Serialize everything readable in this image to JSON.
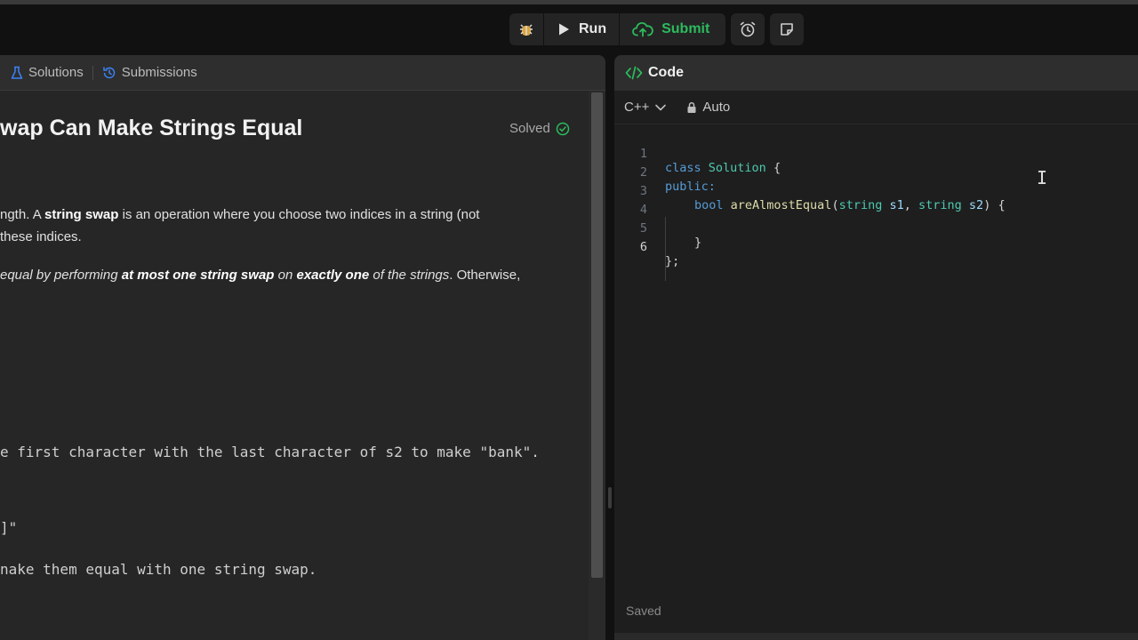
{
  "toolbar": {
    "run_label": "Run",
    "submit_label": "Submit",
    "submit_color": "#2cbb5d"
  },
  "left_tabs": [
    {
      "label": "Solutions",
      "icon": "flask-icon"
    },
    {
      "label": "Submissions",
      "icon": "history-icon"
    }
  ],
  "problem": {
    "title": "wap Can Make Strings Equal",
    "status": "Solved",
    "status_color": "#2cbb5d",
    "desc1_a": "ngth. A ",
    "desc1_b": "string swap",
    "desc1_c": " is an operation where you choose two indices in a string (not",
    "desc2": "these indices.",
    "desc3_a": "equal by performing ",
    "desc3_b": "at most one string swap",
    "desc3_c": " on ",
    "desc3_d": "exactly one",
    "desc3_e": " of the strings",
    "desc3_f": ". Otherwise,",
    "example1_explanation": "e first character with the last character of s2 to make \"bank\".",
    "example2_fragment": "]\"",
    "example2_explanation": "nake them equal with one string swap."
  },
  "editor": {
    "panel_title": "Code",
    "language": "C++",
    "mode": "Auto",
    "status": "Saved",
    "lines": [
      {
        "num": "1",
        "t1": "class ",
        "t2": "Solution",
        "t3": " {"
      },
      {
        "num": "2",
        "t1": "public:"
      },
      {
        "num": "3",
        "t1": "bool ",
        "t2": "areAlmostEqual",
        "t3": "(",
        "t4": "string ",
        "t5": "s1",
        "t6": ", ",
        "t7": "string ",
        "t8": "s2",
        "t9": ") {"
      },
      {
        "num": "4"
      },
      {
        "num": "5",
        "t1": "}"
      },
      {
        "num": "6",
        "t1": "};"
      }
    ]
  }
}
